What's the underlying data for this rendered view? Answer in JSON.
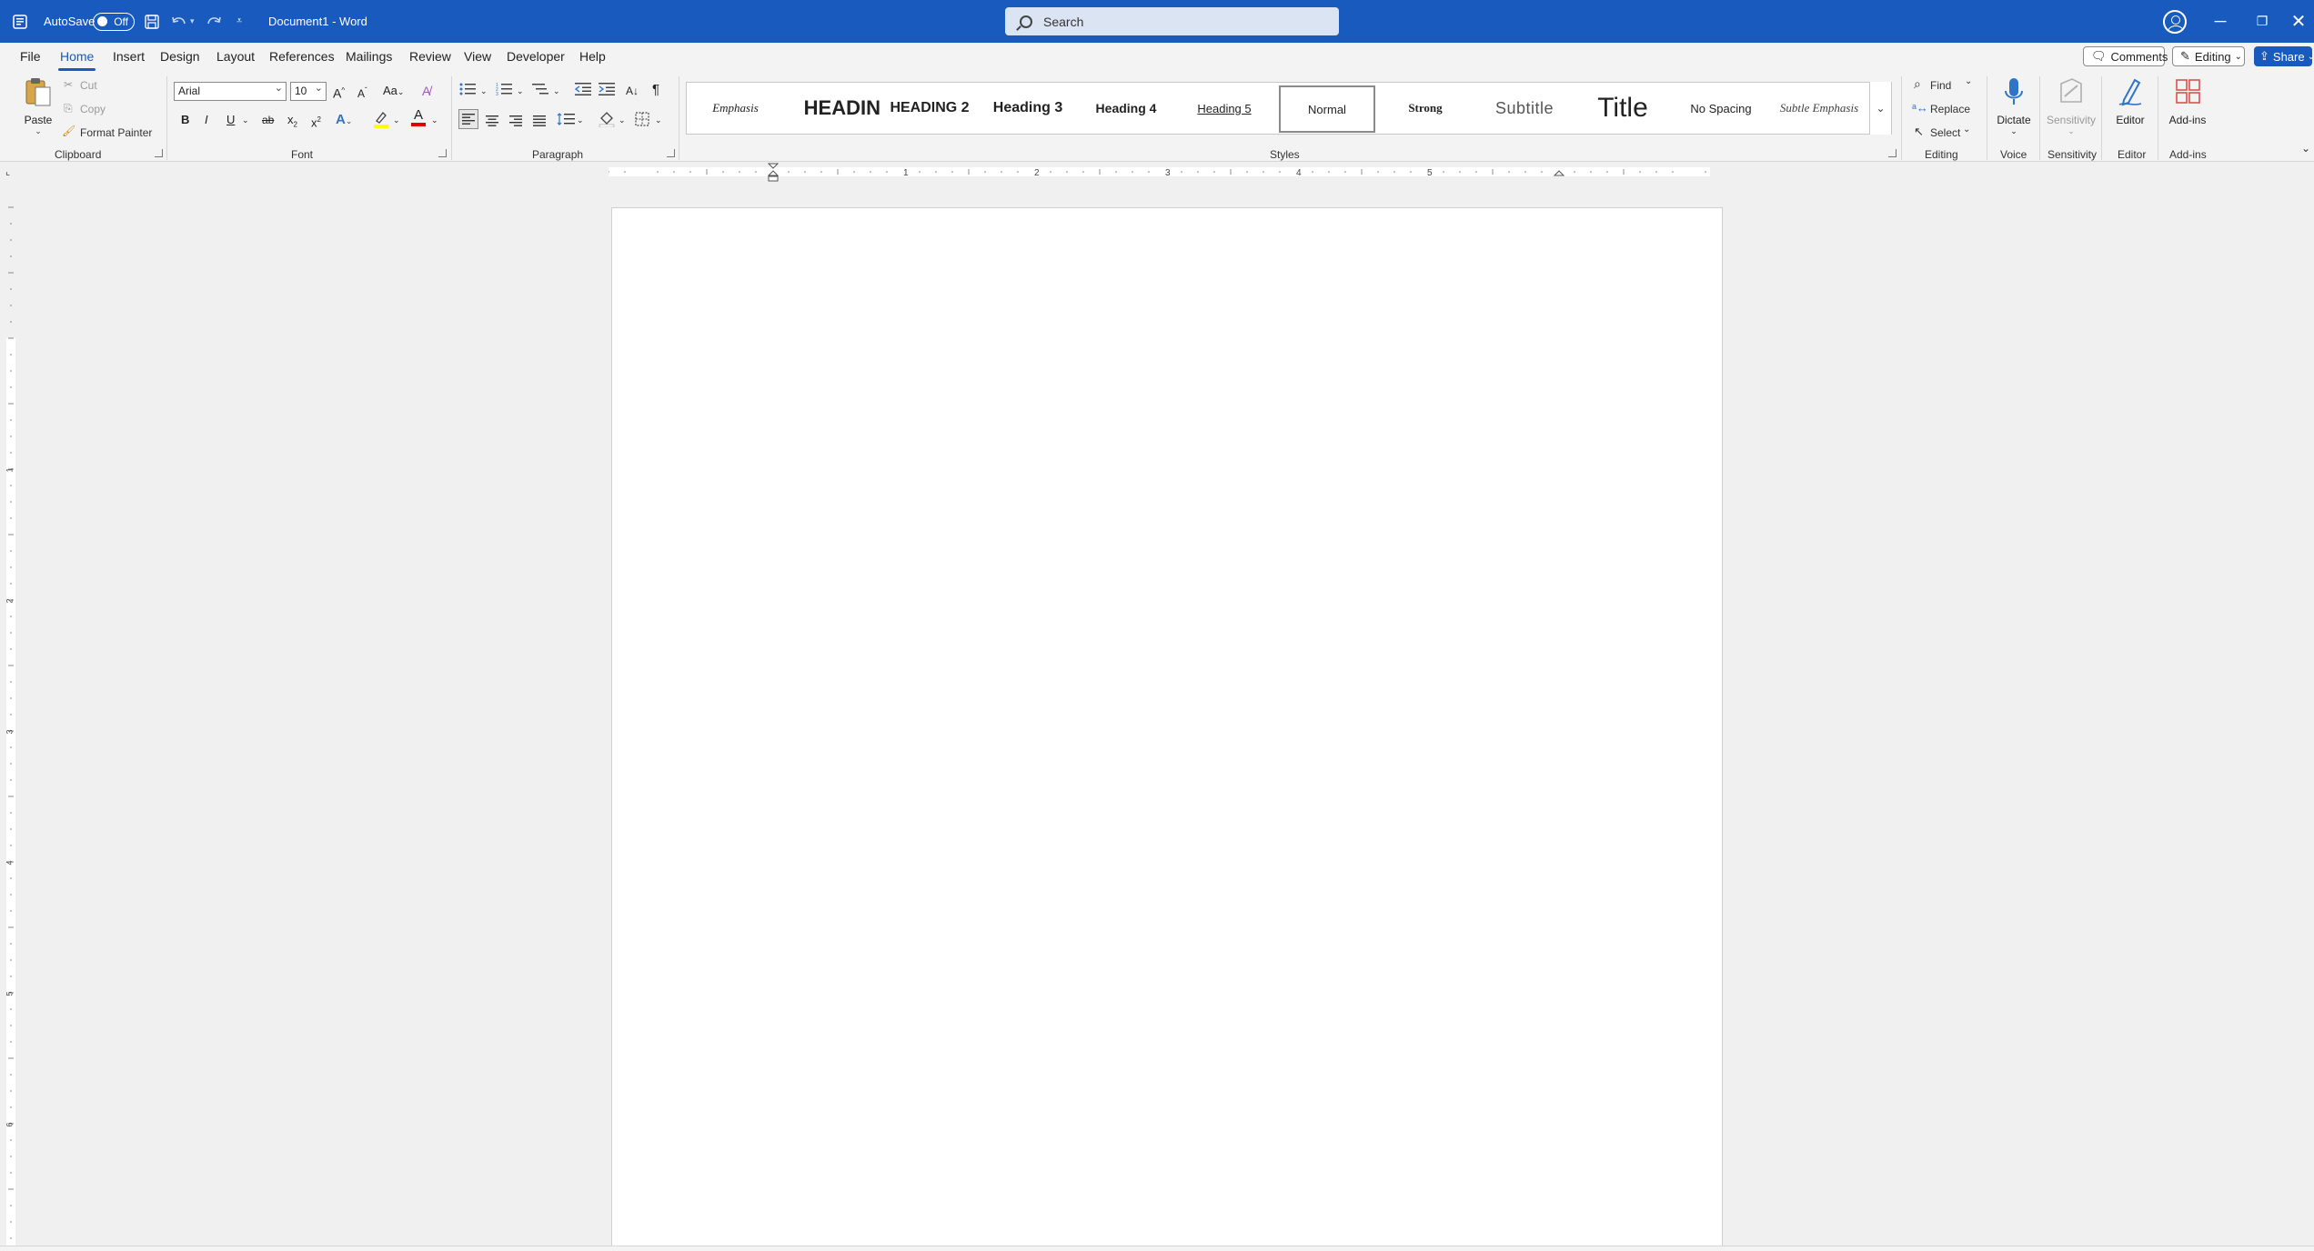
{
  "titlebar": {
    "autosave_label": "AutoSave",
    "autosave_state": "Off",
    "doc_title": "Document1 - Word",
    "search_placeholder": "Search",
    "icons": [
      "word-app-icon",
      "save-icon",
      "undo-icon",
      "redo-icon",
      "customize-qat-icon",
      "account-icon",
      "minimize-icon",
      "restore-icon",
      "close-icon"
    ]
  },
  "menu": {
    "tabs": [
      "File",
      "Home",
      "Insert",
      "Design",
      "Layout",
      "References",
      "Mailings",
      "Review",
      "View",
      "Developer",
      "Help"
    ],
    "active_tab": "Home",
    "comments_label": "Comments",
    "editing_label": "Editing",
    "share_label": "Share"
  },
  "clipboard": {
    "paste_label": "Paste",
    "cut_label": "Cut",
    "copy_label": "Copy",
    "format_painter_label": "Format Painter",
    "group_label": "Clipboard"
  },
  "font": {
    "font_name": "Arial",
    "font_size": "10",
    "group_label": "Font",
    "bold": "B",
    "italic": "I",
    "underline": "U",
    "strike": "ab",
    "grow": "A",
    "shrink": "A",
    "case": "Aa",
    "subscript": "x",
    "superscript": "x",
    "effects": "A",
    "font_color": "A"
  },
  "paragraph": {
    "group_label": "Paragraph",
    "pilcrow": "¶"
  },
  "styles": {
    "group_label": "Styles",
    "items": [
      {
        "label": "Emphasis"
      },
      {
        "label": "HEADIN"
      },
      {
        "label": "HEADING 2"
      },
      {
        "label": "Heading 3"
      },
      {
        "label": "Heading 4"
      },
      {
        "label": "Heading 5"
      },
      {
        "label": "Normal"
      },
      {
        "label": "Strong"
      },
      {
        "label": "Subtitle"
      },
      {
        "label": "Title"
      },
      {
        "label": "No Spacing"
      },
      {
        "label": "Subtle Emphasis"
      }
    ],
    "selected": "Normal"
  },
  "editing": {
    "find_label": "Find",
    "replace_label": "Replace",
    "select_label": "Select",
    "group_label": "Editing"
  },
  "voice": {
    "dictate_label": "Dictate",
    "group_label": "Voice"
  },
  "sensitivity": {
    "button_label": "Sensitivity",
    "group_label": "Sensitivity"
  },
  "editor": {
    "button_label": "Editor",
    "group_label": "Editor"
  },
  "addins": {
    "button_label": "Add-ins",
    "group_label": "Add-ins"
  },
  "ruler": {
    "h_numbers": [
      "1",
      "2",
      "3",
      "4",
      "5"
    ],
    "v_numbers": [
      "1",
      "2",
      "3",
      "4",
      "5",
      "6"
    ]
  },
  "colors": {
    "title_bar": "#185abd",
    "highlight_yellow": "#ffff00",
    "font_red": "#e00000"
  }
}
